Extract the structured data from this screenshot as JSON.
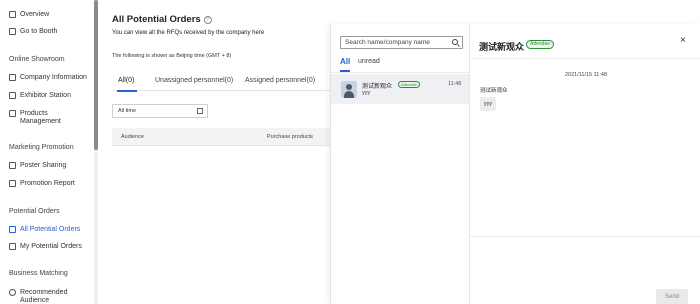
{
  "sidebar": {
    "items_top": [
      {
        "label": "Overview"
      },
      {
        "label": "Go to Booth"
      }
    ],
    "sections": [
      {
        "label": "Online Showroom"
      },
      {
        "label": "Marketing Promotion"
      },
      {
        "label": "Potential Orders"
      },
      {
        "label": "Business Matching"
      }
    ],
    "online_showroom": [
      {
        "label": "Company Information"
      },
      {
        "label": "Exhibitor Station"
      },
      {
        "label": "Products Management"
      }
    ],
    "marketing": [
      {
        "label": "Poster Sharing"
      },
      {
        "label": "Promotion Report"
      }
    ],
    "potential_orders": [
      {
        "label": "All Potential Orders"
      },
      {
        "label": "My Potential Orders"
      }
    ],
    "business_matching": [
      {
        "label": "Recommended Audience"
      }
    ]
  },
  "main": {
    "title": "All Potential Orders",
    "info_icon": "?",
    "description": "You can view all the RFQs received by the company here",
    "note": "The following is shown as Beijing time (GMT + 8)",
    "tabs": [
      {
        "label": "All(0)"
      },
      {
        "label": "Unassigned personnel(0)"
      },
      {
        "label": "Assigned personnel(0)"
      }
    ],
    "time_filter": "All time",
    "table_headers": [
      "Audience",
      "Purchase products"
    ]
  },
  "chat": {
    "search_placeholder": "Search name/company name",
    "tabs": {
      "all": "All",
      "unread": "unread"
    },
    "conversation": {
      "name": "测试新观众",
      "badge": "Attendee",
      "time": "11:48",
      "message": "yyy"
    },
    "header": {
      "name": "测试新观众",
      "badge": "Attendee",
      "close": "×"
    },
    "messages": [
      {
        "timestamp": "2021/11/15 11:48",
        "sender": "测试新观众",
        "text": "yyy"
      }
    ],
    "send_label": "Send"
  },
  "colors": {
    "accent": "#2a5fd0",
    "badge_green": "#2e8b3d"
  }
}
